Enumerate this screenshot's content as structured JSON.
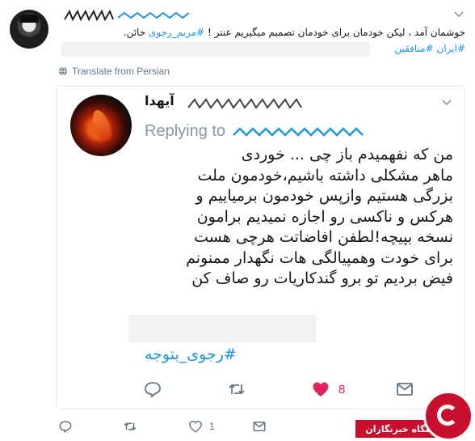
{
  "tweet": {
    "text_prefix": "خوشمان آمد ، لیکن خودمان برای خودمان تصمیم میگیریم عنتر ! ",
    "hashtag_1": "#مریم_رجوی",
    "text_suffix": " خائن.",
    "hashtag_2": "#ایران",
    "hashtag_3": "#منافقین",
    "translate_label": "Translate from Persian"
  },
  "quoted": {
    "name": "آیهدا",
    "replying_label": "Replying to",
    "body_lines": [
      "من که نفهمیدم باز چی ... خوردی",
      "ماهر مشکلی داشته باشیم،خودمون ملت",
      "بزرگی هستیم وازپس خودمون برمیاییم و",
      "هرکس و ناکسی رو اجازه نمیدیم برامون",
      "نسخه بپیچه!لطفن افاضاتت هرچی هست",
      "برای خودت وهمپیالگی هات نگهدار ممنونم",
      "فیض بردیم تو برو گندکاریات رو صاف کن"
    ],
    "hashtag": "#رجوی_بتوجه",
    "actions": {
      "like_count": "8"
    }
  },
  "outer_actions": {
    "like_count": "1"
  },
  "watermark": {
    "label": "باشگاه خبرنگاران"
  },
  "icons": {
    "reply": "reply-icon",
    "retweet": "retweet-icon",
    "like": "heart-icon",
    "message": "message-icon",
    "globe": "globe-icon",
    "caret": "chevron-down-icon"
  },
  "colors": {
    "hashtag": "#1b95e0",
    "like_active": "#e0245e",
    "muted": "#657786",
    "watermark": "#c8102e"
  }
}
